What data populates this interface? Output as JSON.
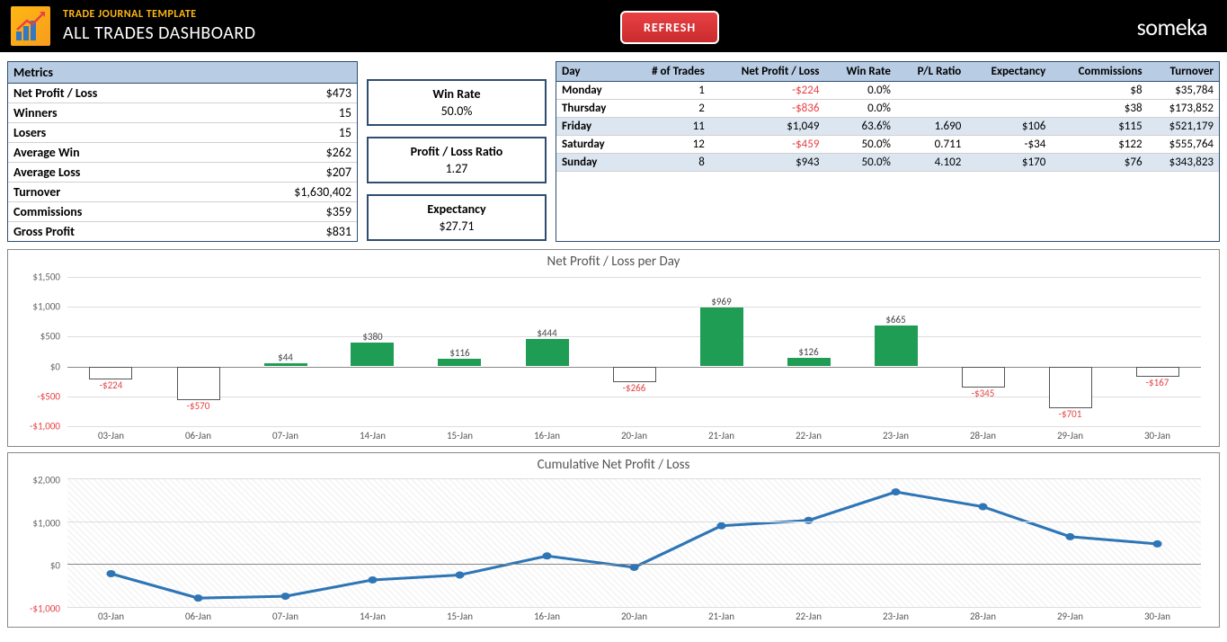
{
  "header": {
    "subtitle": "TRADE JOURNAL TEMPLATE",
    "title": "ALL TRADES DASHBOARD",
    "refresh": "REFRESH",
    "brand": "someka"
  },
  "metrics": {
    "header": "Metrics",
    "rows": [
      {
        "label": "Net Profit / Loss",
        "value": "$473"
      },
      {
        "label": "Winners",
        "value": "15"
      },
      {
        "label": "Losers",
        "value": "15"
      },
      {
        "label": "Average Win",
        "value": "$262"
      },
      {
        "label": "Average Loss",
        "value": "$207"
      },
      {
        "label": "Turnover",
        "value": "$1,630,402"
      },
      {
        "label": "Commissions",
        "value": "$359"
      },
      {
        "label": "Gross Profit",
        "value": "$831"
      }
    ]
  },
  "kpi": [
    {
      "label": "Win Rate",
      "value": "50.0%"
    },
    {
      "label": "Profit / Loss Ratio",
      "value": "1.27"
    },
    {
      "label": "Expectancy",
      "value": "$27.71"
    }
  ],
  "day_table": {
    "headers": [
      "Day",
      "# of Trades",
      "Net Profit / Loss",
      "Win Rate",
      "P/L Ratio",
      "Expectancy",
      "Commissions",
      "Turnover"
    ],
    "rows": [
      {
        "day": "Monday",
        "trades": "1",
        "npl": "-$224",
        "npl_neg": true,
        "win": "0.0%",
        "pl": "",
        "exp": "",
        "comm": "$8",
        "turn": "$35,784"
      },
      {
        "day": "Thursday",
        "trades": "2",
        "npl": "-$836",
        "npl_neg": true,
        "win": "0.0%",
        "pl": "",
        "exp": "",
        "comm": "$38",
        "turn": "$173,852"
      },
      {
        "day": "Friday",
        "trades": "11",
        "npl": "$1,049",
        "npl_neg": false,
        "win": "63.6%",
        "pl": "1.690",
        "exp": "$106",
        "comm": "$115",
        "turn": "$521,179",
        "alt": true
      },
      {
        "day": "Saturday",
        "trades": "12",
        "npl": "-$459",
        "npl_neg": true,
        "win": "50.0%",
        "pl": "0.711",
        "exp": "-$34",
        "comm": "$122",
        "turn": "$555,764"
      },
      {
        "day": "Sunday",
        "trades": "8",
        "npl": "$943",
        "npl_neg": false,
        "win": "50.0%",
        "pl": "4.102",
        "exp": "$170",
        "comm": "$76",
        "turn": "$343,823",
        "alt": true
      }
    ]
  },
  "chart_data": [
    {
      "type": "bar",
      "title": "Net Profit / Loss per Day",
      "categories": [
        "03-Jan",
        "06-Jan",
        "07-Jan",
        "14-Jan",
        "15-Jan",
        "16-Jan",
        "20-Jan",
        "21-Jan",
        "22-Jan",
        "23-Jan",
        "28-Jan",
        "29-Jan",
        "30-Jan"
      ],
      "values": [
        -224,
        -570,
        44,
        380,
        116,
        444,
        -266,
        969,
        126,
        665,
        -345,
        -701,
        -167
      ],
      "ylim": [
        -1000,
        1500
      ],
      "yticks": [
        -1000,
        -500,
        0,
        500,
        1000,
        1500
      ]
    },
    {
      "type": "line",
      "title": "Cumulative Net Profit / Loss",
      "categories": [
        "03-Jan",
        "06-Jan",
        "07-Jan",
        "14-Jan",
        "15-Jan",
        "16-Jan",
        "20-Jan",
        "21-Jan",
        "22-Jan",
        "23-Jan",
        "28-Jan",
        "29-Jan",
        "30-Jan"
      ],
      "values": [
        -224,
        -794,
        -750,
        -370,
        -254,
        190,
        -76,
        893,
        1019,
        1684,
        1339,
        638,
        471
      ],
      "ylim": [
        -1000,
        2000
      ],
      "yticks": [
        -1000,
        0,
        1000,
        2000
      ]
    }
  ]
}
